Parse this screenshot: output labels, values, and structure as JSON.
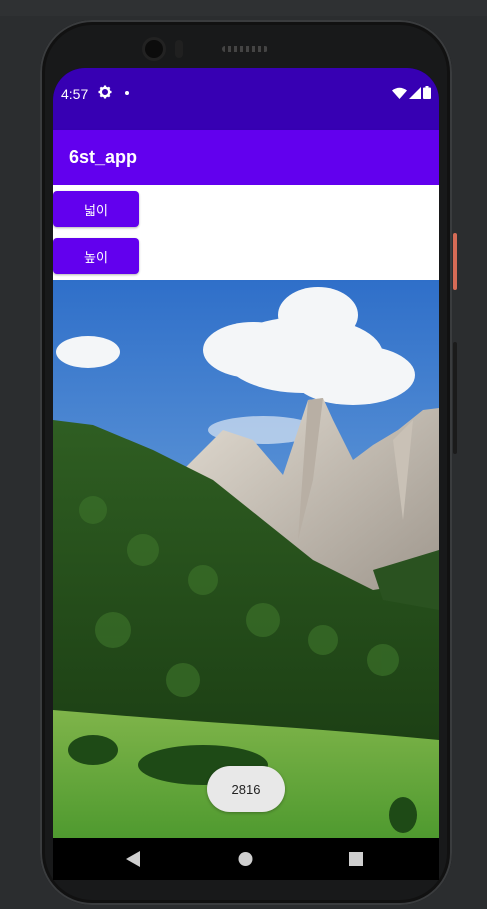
{
  "status_bar": {
    "time": "4:57",
    "icons": [
      "settings-icon",
      "notification-dot-icon",
      "wifi-icon",
      "signal-icon",
      "battery-icon"
    ]
  },
  "app_bar": {
    "title": "6st_app"
  },
  "buttons": {
    "width_label": "넓이",
    "height_label": "높이"
  },
  "toast": {
    "text": "2816"
  },
  "nav_bar": {
    "icons": [
      "back-icon",
      "home-icon",
      "recents-icon"
    ]
  },
  "colors": {
    "status_bar": "#3700b3",
    "app_bar": "#6200ee",
    "button": "#6200ee"
  }
}
